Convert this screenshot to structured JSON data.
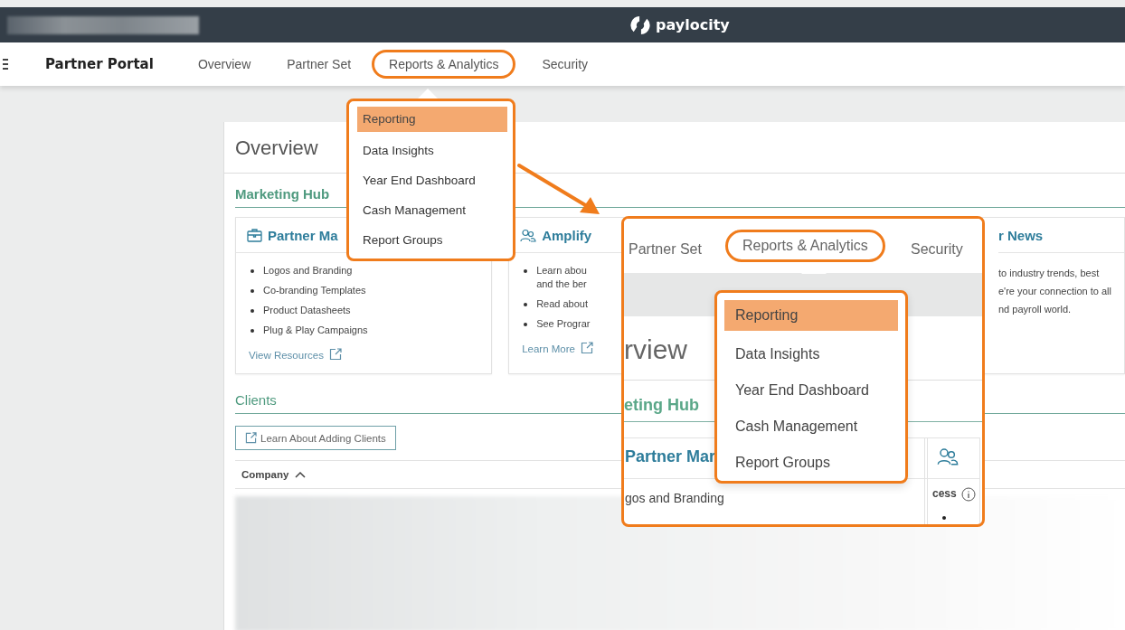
{
  "header": {
    "logo": "paylocity"
  },
  "nav": {
    "title": "Partner Portal",
    "items": [
      {
        "label": "Overview",
        "selected": false
      },
      {
        "label": "Partner Set",
        "selected": false
      },
      {
        "label": "Reports & Analytics",
        "selected": true
      },
      {
        "label": "Security",
        "selected": false
      }
    ]
  },
  "dropdown": {
    "items": [
      {
        "label": "Reporting",
        "selected": true
      },
      {
        "label": "Data Insights",
        "selected": false
      },
      {
        "label": "Year End Dashboard",
        "selected": false
      },
      {
        "label": "Cash Management",
        "selected": false
      },
      {
        "label": "Report Groups",
        "selected": false
      }
    ]
  },
  "page": {
    "title": "Overview",
    "marketing_hub": {
      "title": "Marketing Hub",
      "cards": [
        {
          "kind": "list",
          "title": "Partner Ma",
          "bullets": [
            {
              "lines": [
                "Logos and Branding"
              ]
            },
            {
              "lines": [
                "Co-branding Templates"
              ]
            },
            {
              "lines": [
                "Product Datasheets"
              ]
            },
            {
              "lines": [
                "Plug & Play Campaigns"
              ]
            }
          ],
          "link": "View Resources"
        },
        {
          "kind": "list",
          "title": "Amplify",
          "bullets": [
            {
              "lines": [
                "Learn abou",
                "and the ber"
              ]
            },
            {
              "lines": [
                "Read about"
              ]
            },
            {
              "lines": [
                "See Prograr"
              ]
            }
          ],
          "link": "Learn More"
        },
        {
          "kind": "text",
          "title": "r News",
          "lines": [
            "to industry trends, best",
            "e're your connection to all",
            "nd payroll world."
          ]
        }
      ]
    },
    "clients": {
      "title": "Clients",
      "button": "Learn About Adding Clients",
      "columns": [
        {
          "label": "Company",
          "sort_ascending": true
        }
      ]
    }
  },
  "callout": {
    "nav": [
      {
        "label": "Partner Set",
        "selected": false
      },
      {
        "label": "Reports & Analytics",
        "selected": true
      },
      {
        "label": "Security",
        "selected": false
      }
    ],
    "dropdown": [
      {
        "label": "Reporting",
        "selected": true
      },
      {
        "label": "Data Insights",
        "selected": false
      },
      {
        "label": "Year End Dashboard",
        "selected": false
      },
      {
        "label": "Cash Management",
        "selected": false
      },
      {
        "label": "Report Groups",
        "selected": false
      }
    ],
    "title": "rview",
    "section": "eting Hub",
    "card_title": "Partner Mar",
    "bullet": "gos and Branding",
    "side_text": "cess"
  }
}
